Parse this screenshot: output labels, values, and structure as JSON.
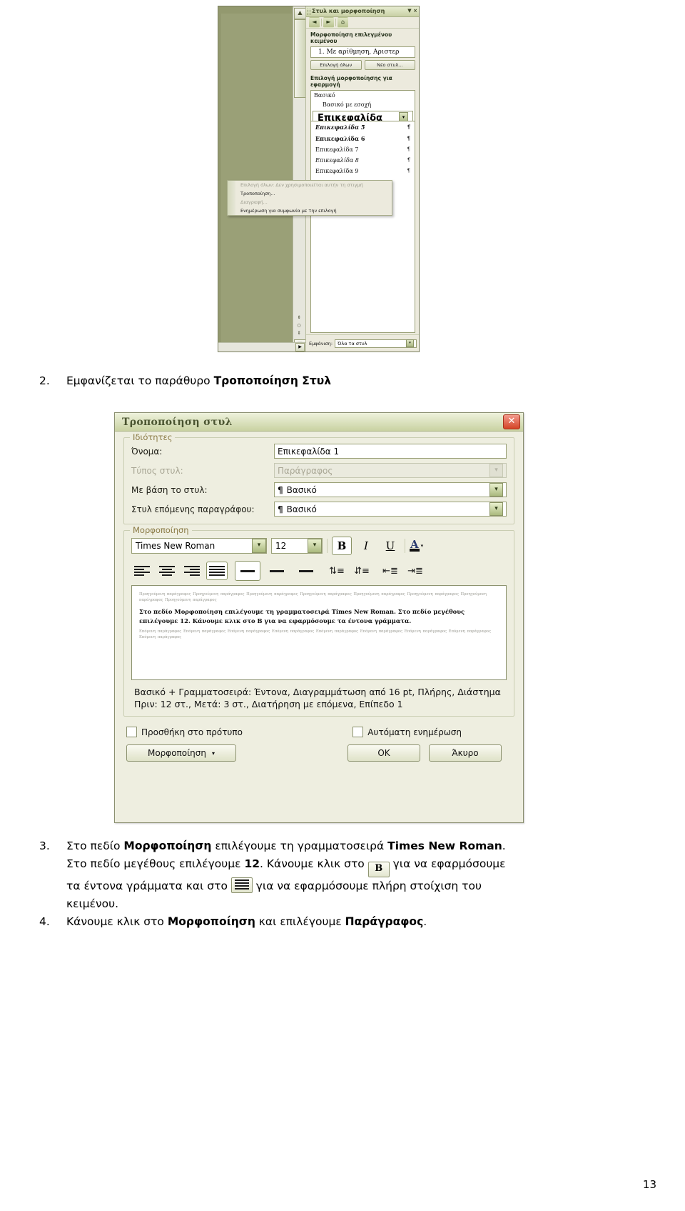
{
  "screenshot_top": {
    "pane": {
      "title": "Στυλ και μορφοποίηση",
      "close": "×",
      "dropdown": "▼",
      "toolbar_icons": [
        "back-icon",
        "forward-icon",
        "home-icon"
      ],
      "section1_heading": "Μορφοποίηση επιλεγμένου κειμένου",
      "current_style": "1.  Με αρίθμηση, Αριστερ",
      "buttons": {
        "select_all": "Επιλογή όλων",
        "new_style": "Νέο στυλ..."
      },
      "section2_heading": "Επιλογή μορφοποίησης για εφαρμογή",
      "top_styles": [
        "Βασικό",
        "Βασικό με εσοχή"
      ],
      "selected_style": "Επικεφαλίδα",
      "list_styles": [
        {
          "name": "Επικεφαλίδα 5",
          "mark": "¶"
        },
        {
          "name": "Επικεφαλίδα 6",
          "mark": "¶"
        },
        {
          "name": "Επικεφαλίδα 7",
          "mark": "¶"
        },
        {
          "name": "Επικεφαλίδα 8",
          "mark": "¶"
        },
        {
          "name": "Επικεφαλίδα 9",
          "mark": "¶"
        }
      ],
      "footer_label": "Εμφάνιση:",
      "footer_value": "Όλα τα στυλ"
    },
    "context_menu": {
      "items": [
        {
          "label": "Επιλογή όλων: Δεν χρησιμοποιείται αυτήν τη στιγμή",
          "disabled": true
        },
        {
          "label": "Τροποποίηση...",
          "disabled": false
        },
        {
          "label": "Διαγραφή...",
          "disabled": true
        },
        {
          "label": "Ενημέρωση για συμφωνία με την επιλογή",
          "disabled": false
        }
      ]
    }
  },
  "step2": {
    "number": "2.",
    "text_before": "Εμφανίζεται το παράθυρο ",
    "bold": "Τροποποίηση Στυλ"
  },
  "dialog": {
    "title": "Τροποποίηση στυλ",
    "close_label": "✕",
    "properties_legend": "Ιδιότητες",
    "fields": [
      {
        "label": "Όνομα:",
        "value": "Επικεφαλίδα 1",
        "type": "text",
        "disabled": false
      },
      {
        "label": "Τύπος στυλ:",
        "value": "Παράγραφος",
        "type": "combo",
        "disabled": true
      },
      {
        "label": "Με βάση το στυλ:",
        "value": "Βασικό",
        "pilcrow": "¶",
        "type": "combo",
        "disabled": false
      },
      {
        "label": "Στυλ επόμενης παραγράφου:",
        "value": "Βασικό",
        "pilcrow": "¶",
        "type": "combo",
        "disabled": false
      }
    ],
    "formatting_legend": "Μορφοποίηση",
    "font_name": "Times New Roman",
    "font_size": "12",
    "bold_label": "B",
    "italic_label": "I",
    "underline_label": "U",
    "font_color_label": "A",
    "caret": "▾",
    "dropdown_glyph": "▾",
    "preview_lorem": "Προηγούμενη παράγραφος Προηγούμενη παράγραφος Προηγούμενη παράγραφος Προηγούμενη παράγραφος Προηγούμενη παράγραφος Προηγούμενη παράγραφος Προηγούμενη παράγραφος Προηγούμενη παράγραφος",
    "preview_main": "Στο πεδίο Μορφοποίηση επιλέγουμε τη γραμματοσειρά Times New Roman. Στο πεδίο μεγέθους επιλέγουμε 12. Κάνουμε κλικ στο B για να εφαρμόσουμε τα έντονα γράμματα.",
    "preview_lorem_after": "Επόμενη παράγραφος Επόμενη παράγραφος Επόμενη παράγραφος Επόμενη παράγραφος Επόμενη παράγραφος Επόμενη παράγραφος Επόμενη παράγραφος Επόμενη παράγραφος Επόμενη παράγραφος",
    "description_line1": "Βασικό + Γραμματοσειρά: Έντονα, Διαγραμμάτωση από 16 pt, Πλήρης, Διάστημα",
    "description_line2": "Πριν:  12 στ., Μετά:  3 στ., Διατήρηση με επόμενα, Επίπεδο 1",
    "checkbox_add_template": "Προσθήκη στο πρότυπο",
    "checkbox_auto_update": "Αυτόματη ενημέρωση",
    "format_button": "Μορφοποίηση",
    "ok_button": "OK",
    "cancel_button": "Άκυρο"
  },
  "step3": {
    "number": "3.",
    "seg1": "Στο πεδίο ",
    "bold1": "Μορφοποίηση",
    "seg2": " επιλέγουμε τη γραμματοσειρά ",
    "bold2": "Times New Roman",
    "seg3": ".",
    "seg4": "Στο πεδίο μεγέθους επιλέγουμε ",
    "bold3": "12",
    "seg5": ". Κάνουμε κλικ στο ",
    "icon1": "bold-button-icon",
    "icon1_label": "B",
    "seg6": " για να εφαρμόσουμε",
    "seg7": "τα έντονα γράμματα και στο ",
    "icon2": "justify-button-icon",
    "seg8": " για να εφαρμόσουμε πλήρη στοίχιση του",
    "seg9": "κειμένου."
  },
  "step4": {
    "number": "4.",
    "seg1": "Κάνουμε κλικ στο ",
    "bold1": "Μορφοποίηση",
    "seg2": " και επιλέγουμε ",
    "bold2": "Παράγραφος",
    "seg3": "."
  },
  "page_number": "13"
}
